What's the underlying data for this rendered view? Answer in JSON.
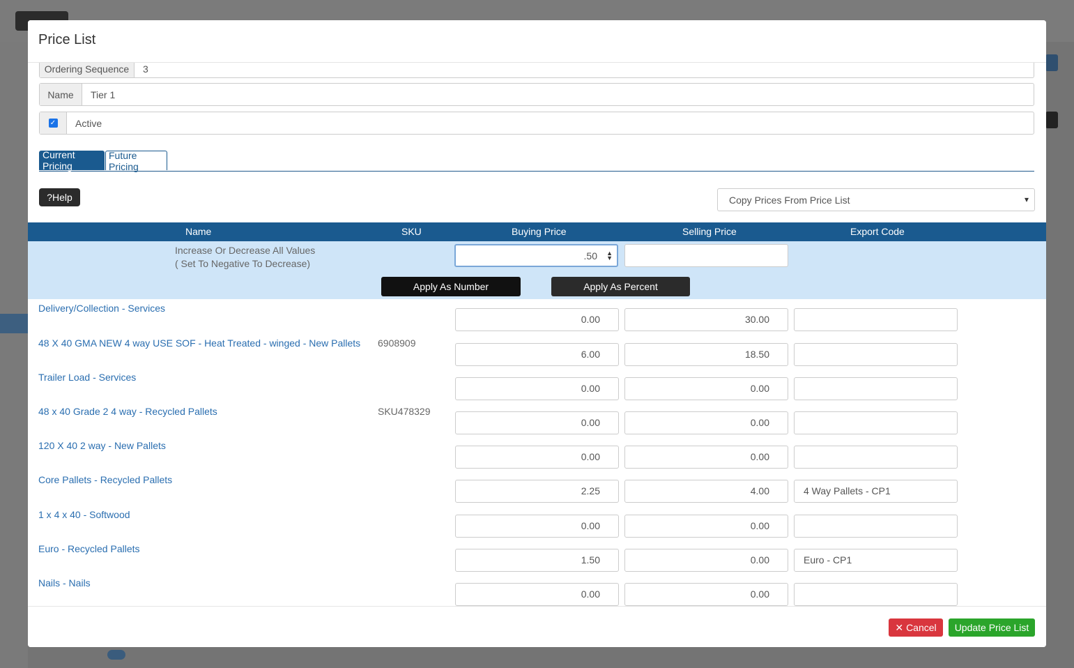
{
  "modal": {
    "title": "Price List"
  },
  "form": {
    "ordering_sequence_label": "Ordering Sequence",
    "ordering_sequence_value": "3",
    "name_label": "Name",
    "name_value": "Tier 1",
    "active_label": "Active",
    "active_checked": true
  },
  "tabs": [
    {
      "label": "Current Pricing",
      "active": true
    },
    {
      "label": "Future Pricing",
      "active": false
    }
  ],
  "help_label": "?Help",
  "copy_select": {
    "selected": "Copy Prices From Price List"
  },
  "table": {
    "headers": [
      "Name",
      "SKU",
      "Buying Price",
      "Selling Price",
      "Export Code"
    ],
    "bulk": {
      "label_line1": "Increase Or Decrease All Values",
      "label_line2": "( Set To Negative To Decrease)",
      "buying_value": ".50",
      "selling_value": "",
      "apply_number": "Apply As Number",
      "apply_percent": "Apply As Percent"
    },
    "rows": [
      {
        "name": "Delivery/Collection - Services",
        "sku": "",
        "buying": "0.00",
        "selling": "30.00",
        "export": ""
      },
      {
        "name": "48 X 40 GMA NEW 4 way USE SOF - Heat Treated - winged - New Pallets",
        "sku": "6908909",
        "buying": "6.00",
        "selling": "18.50",
        "export": ""
      },
      {
        "name": "Trailer Load - Services",
        "sku": "",
        "buying": "0.00",
        "selling": "0.00",
        "export": ""
      },
      {
        "name": "48 x 40 Grade 2 4 way - Recycled Pallets",
        "sku": "SKU478329",
        "buying": "0.00",
        "selling": "0.00",
        "export": ""
      },
      {
        "name": "120 X 40 2 way - New Pallets",
        "sku": "",
        "buying": "0.00",
        "selling": "0.00",
        "export": ""
      },
      {
        "name": "Core Pallets - Recycled Pallets",
        "sku": "",
        "buying": "2.25",
        "selling": "4.00",
        "export": "4 Way Pallets - CP1"
      },
      {
        "name": "1 x 4 x 40 - Softwood",
        "sku": "",
        "buying": "0.00",
        "selling": "0.00",
        "export": ""
      },
      {
        "name": "Euro - Recycled Pallets",
        "sku": "",
        "buying": "1.50",
        "selling": "0.00",
        "export": "Euro - CP1"
      },
      {
        "name": "Nails - Nails",
        "sku": "",
        "buying": "0.00",
        "selling": "0.00",
        "export": ""
      }
    ]
  },
  "footer": {
    "cancel_label": "Cancel",
    "update_label": "Update Price List"
  },
  "colors": {
    "primary": "#1a5a8f",
    "bulk_bg": "#cfe5f8",
    "cancel": "#d9363e",
    "update": "#2ba52b",
    "link": "#2a6eb0"
  }
}
